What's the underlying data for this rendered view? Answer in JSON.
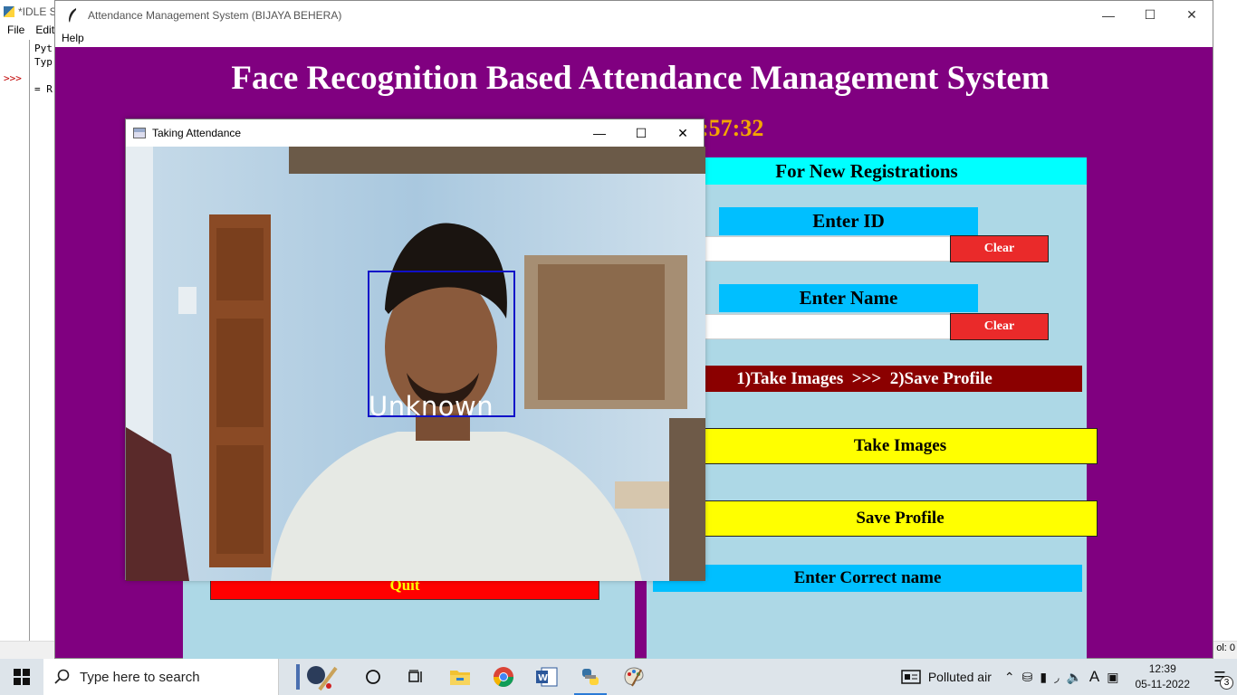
{
  "idle": {
    "title": "*IDLE S",
    "menu": [
      "File",
      "Edit"
    ],
    "lines": [
      "Pyt",
      "Typ",
      "",
      "= R"
    ],
    "prompt": ">>>",
    "colinfo": "ol: 0"
  },
  "main_window": {
    "title": "Attendance Management System (BIJAYA BEHERA)",
    "menu_help": "Help",
    "heading": "Face Recognition Based Attendance Management System",
    "clock": ":57:32",
    "quit_label": "Quit",
    "registration": {
      "header": "For New Registrations",
      "enter_id_label": "Enter ID",
      "id_value": "",
      "clear_id_label": "Clear",
      "enter_name_label": "Enter Name",
      "name_value": "",
      "clear_name_label": "Clear",
      "steps": "1)Take Images  >>>  2)Save Profile",
      "take_images_label": "Take Images",
      "save_profile_label": "Save Profile",
      "correct_name_label": "Enter Correct name"
    },
    "colors": {
      "background": "#800080",
      "frame": "#add8e6",
      "header": "#00ffff",
      "label": "#00bfff",
      "clear": "#ea2a2a",
      "steps": "#8b0000",
      "action": "#ffff00"
    }
  },
  "camera_window": {
    "title": "Taking Attendance",
    "face_label": "Unknown"
  },
  "taskbar": {
    "search_placeholder": "Type here to search",
    "weather": "Polluted air",
    "time": "12:39",
    "date": "05-11-2022",
    "notification_count": "3",
    "input_indicator": "A"
  }
}
